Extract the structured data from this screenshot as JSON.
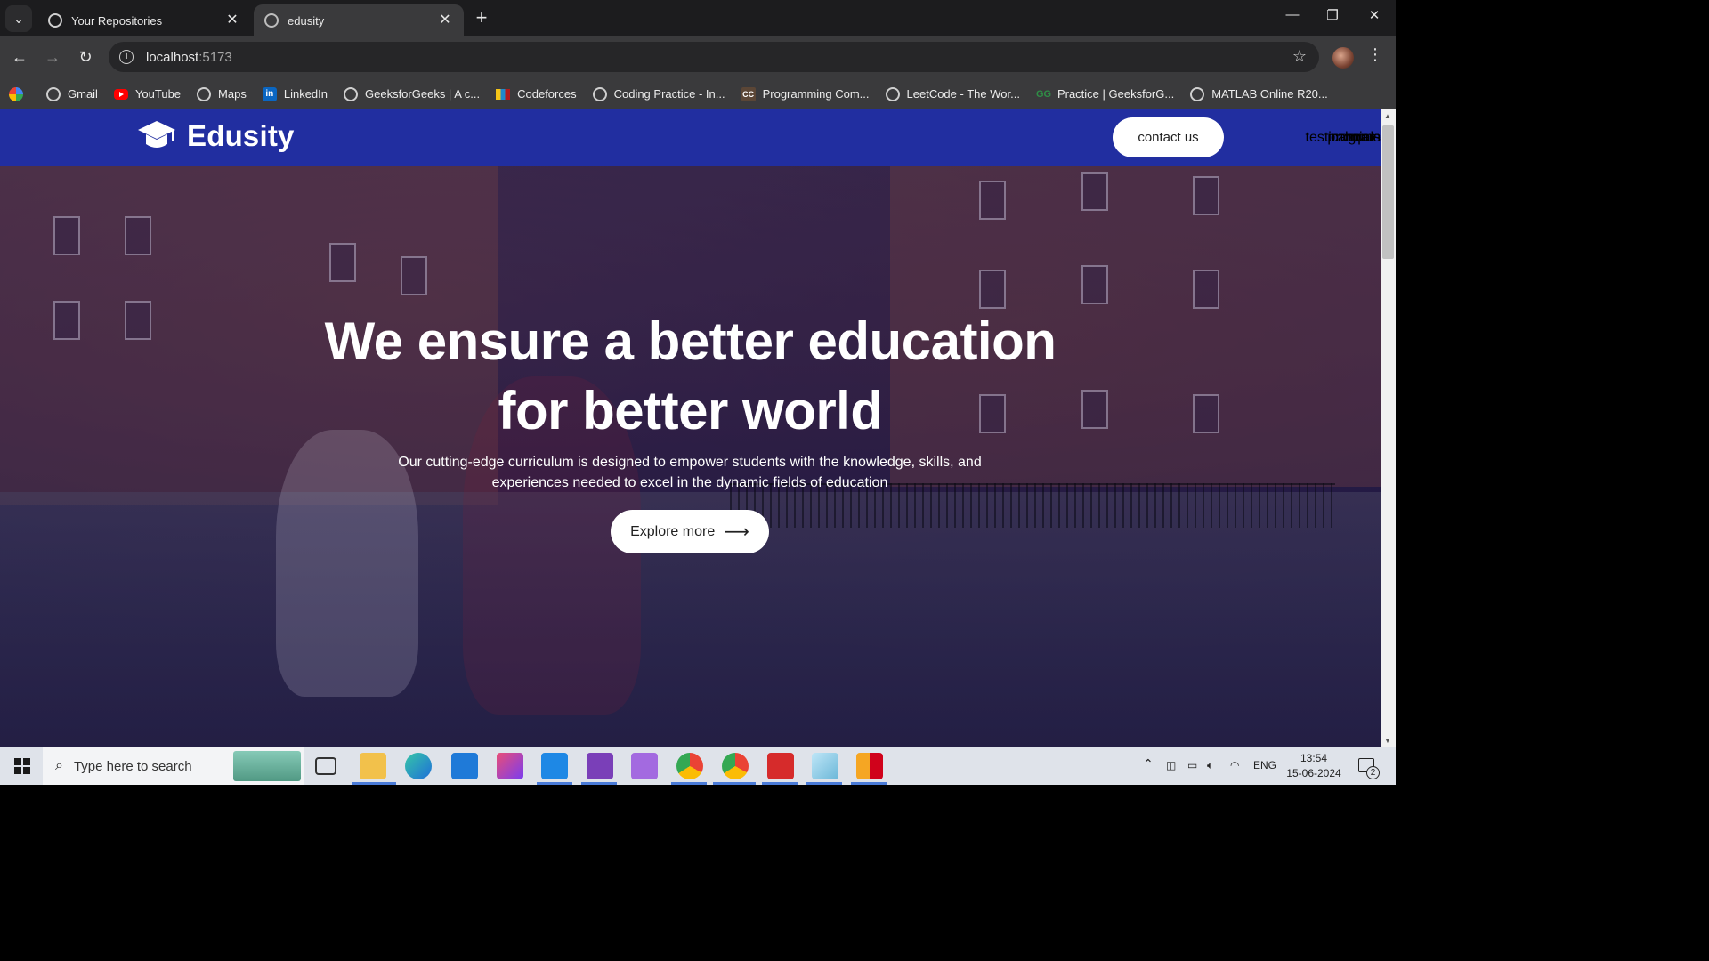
{
  "browser": {
    "tabs": [
      {
        "title": "Your Repositories",
        "active": false,
        "icon": "github-icon"
      },
      {
        "title": "edusity",
        "active": true,
        "icon": "globe-icon"
      }
    ],
    "url_host": "localhost",
    "url_port": ":5173",
    "bookmarks": [
      {
        "label": "Gmail",
        "icon": "globe-icon"
      },
      {
        "label": "YouTube",
        "icon": "youtube-icon"
      },
      {
        "label": "Maps",
        "icon": "globe-icon"
      },
      {
        "label": "LinkedIn",
        "icon": "linkedin-icon"
      },
      {
        "label": "GeeksforGeeks | A c...",
        "icon": "globe-icon"
      },
      {
        "label": "Codeforces",
        "icon": "codeforces-icon"
      },
      {
        "label": "Coding Practice - In...",
        "icon": "globe-icon"
      },
      {
        "label": "Programming Com...",
        "icon": "codechef-icon"
      },
      {
        "label": "LeetCode - The Wor...",
        "icon": "globe-icon"
      },
      {
        "label": "Practice | GeeksforG...",
        "icon": "gfg-icon"
      },
      {
        "label": "MATLAB Online R20...",
        "icon": "globe-icon"
      }
    ]
  },
  "site": {
    "brand": "Edusity",
    "brand_color": "#212ea0",
    "nav": {
      "home": "home",
      "program": "program",
      "campus": "campus",
      "testimonials": "testimonials",
      "contact": "contact us"
    },
    "hero": {
      "title_line1": "We ensure a better education",
      "title_line2": "for better world",
      "subtitle": "Our cutting-edge curriculum is designed to empower students with the knowledge, skills, and experiences needed to excel in the dynamic fields of education",
      "cta": "Explore more"
    }
  },
  "taskbar": {
    "search_placeholder": "Type here to search",
    "language": "ENG",
    "time": "13:54",
    "date": "15-06-2024",
    "notification_count": "2"
  }
}
